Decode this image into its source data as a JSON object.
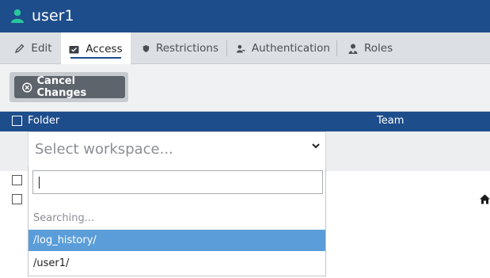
{
  "header": {
    "title": "user1",
    "icon": "user-icon"
  },
  "tabs": [
    {
      "label": "Edit",
      "icon": "pencil-icon",
      "active": false
    },
    {
      "label": "Access",
      "icon": "inbox-check-icon",
      "active": true
    },
    {
      "label": "Restrictions",
      "icon": "shield-icon",
      "active": false
    },
    {
      "label": "Authentication",
      "icon": "user-key-icon",
      "active": false
    },
    {
      "label": "Roles",
      "icon": "person-badge-icon",
      "active": false
    }
  ],
  "toolbar": {
    "cancel_label": "Cancel Changes",
    "cancel_icon": "circle-x-icon"
  },
  "table": {
    "columns": {
      "folder": "Folder",
      "team": "Team"
    }
  },
  "select": {
    "placeholder": "Select workspace...",
    "search_value": "",
    "status": "Searching...",
    "options": [
      "/log_history/",
      "/user1/"
    ],
    "highlighted": "/log_history/"
  },
  "colors": {
    "header_bg": "#1e4d8c",
    "user_icon": "#27c79a",
    "highlight": "#5b9dd9"
  }
}
